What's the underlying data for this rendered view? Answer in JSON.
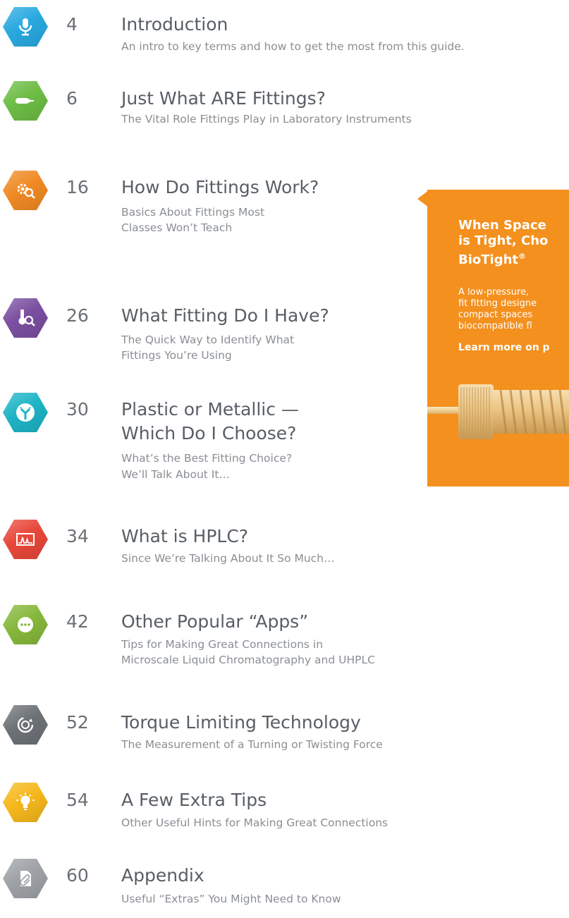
{
  "toc": [
    {
      "page": "4",
      "title": "Introduction",
      "subtitle_lines": [
        "An intro to key terms and how to get the most from this guide."
      ],
      "icon": "microphone-icon",
      "color": "#29a9e0"
    },
    {
      "page": "6",
      "title": "Just What ARE Fittings?",
      "subtitle_lines": [
        "The Vital Role Fittings Play in Laboratory Instruments"
      ],
      "icon": "fitting-icon",
      "color": "#6dbd45"
    },
    {
      "page": "16",
      "title": "How Do Fittings Work?",
      "subtitle_lines": [
        "Basics About Fittings Most",
        "Classes Won’t Teach"
      ],
      "icon": "gear-search-icon",
      "color": "#f08a24"
    },
    {
      "page": "26",
      "title": "What Fitting Do I Have?",
      "subtitle_lines": [
        "The Quick Way to Identify What",
        "Fittings You’re Using"
      ],
      "icon": "flask-search-icon",
      "color": "#7a4fa0"
    },
    {
      "page": "30",
      "title_lines": [
        "Plastic or Metallic —",
        "Which Do I Choose?"
      ],
      "subtitle_lines": [
        "What’s the Best Fitting Choice?",
        "We’ll Talk About It…"
      ],
      "icon": "fork-arrow-icon",
      "color": "#1eb4c6"
    },
    {
      "page": "34",
      "title": "What is HPLC?",
      "subtitle_lines": [
        "Since We’re Talking About It So Much…"
      ],
      "icon": "chromatogram-icon",
      "color": "#e8473a"
    },
    {
      "page": "42",
      "title": "Other Popular “Apps”",
      "subtitle_lines": [
        "Tips for Making Great Connections in",
        "Microscale Liquid Chromatography and UHPLC"
      ],
      "icon": "more-dots-icon",
      "color": "#86b83c"
    },
    {
      "page": "52",
      "title": "Torque Limiting Technology",
      "subtitle_lines": [
        "The Measurement of a Turning or Twisting Force"
      ],
      "icon": "rotation-icon",
      "color": "#6d7277"
    },
    {
      "page": "54",
      "title": "A Few Extra Tips",
      "subtitle_lines": [
        "Other Useful Hints for Making Great Connections"
      ],
      "icon": "lightbulb-icon",
      "color": "#f5b81c"
    },
    {
      "page": "60",
      "title": "Appendix",
      "subtitle_lines": [
        "Useful “Extras” You Might Need to Know"
      ],
      "icon": "attachment-icon",
      "color": "#9ea2a6"
    }
  ],
  "callout": {
    "heading_lines": [
      "When Space",
      "is Tight, Cho",
      "BioTight"
    ],
    "heading_reg": "®",
    "body_lines": [
      "A low-pressure,",
      "fit fitting designe",
      "compact spaces",
      "biocompatible fl"
    ],
    "link": "Learn more on p",
    "bg_color": "#f4901e"
  }
}
